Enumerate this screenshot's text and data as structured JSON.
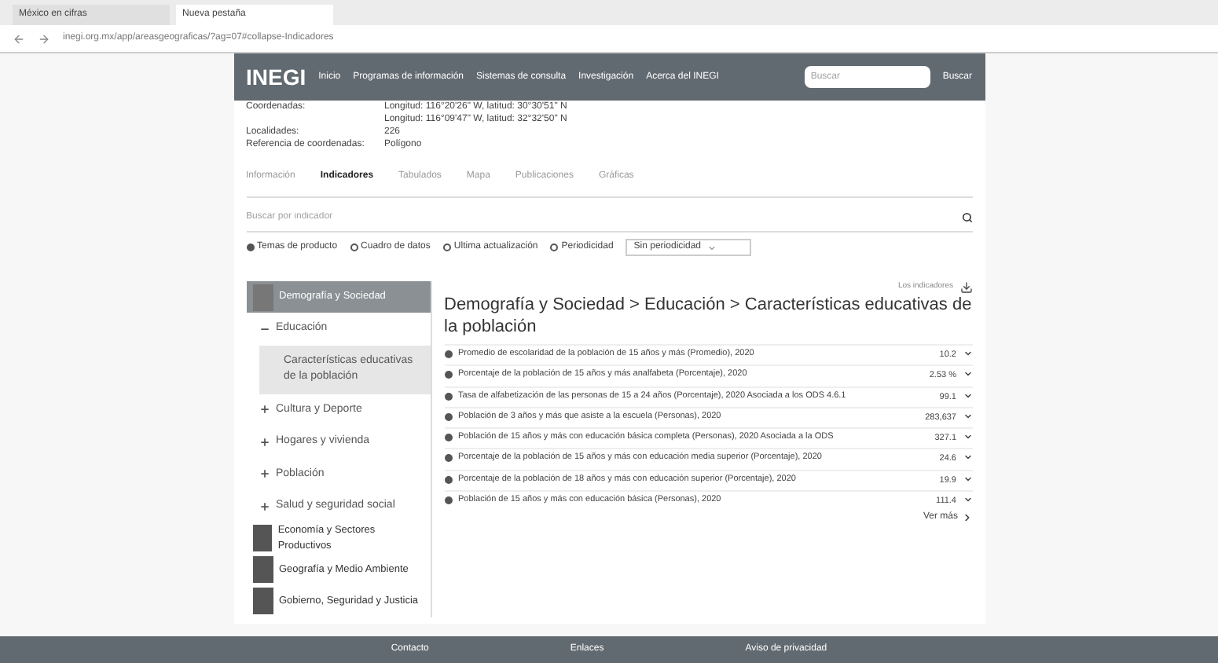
{
  "browser": {
    "tabs": [
      {
        "label": "México en cifras",
        "selected": false
      },
      {
        "label": "Nueva pestaña",
        "selected": true
      }
    ],
    "url": "inegi.org.mx/app/areasgeograficas/?ag=07#collapse-Indicadores"
  },
  "header": {
    "logo": "INEGI",
    "nav": [
      "Inicio",
      "Programas de información",
      "Sistemas de consulta",
      "Investigación",
      "Acerca del INEGI"
    ],
    "search": {
      "placeholder": "Buscar"
    },
    "search_button": "Buscar"
  },
  "info": [
    {
      "label": "Coordenadas:",
      "value": "Longitud: 116°20'26\" W, latitud: 30°30'51\" N"
    },
    {
      "value": "Longitud: 116°09'47\" W, latitud: 32°32'50\" N"
    },
    {
      "label": "Localidades:",
      "value": "226"
    },
    {
      "label": "Referencia de coordenadas:",
      "value": "Polígono"
    }
  ],
  "tabs": [
    {
      "label": "Información",
      "selected": false
    },
    {
      "label": "Indicadores",
      "selected": true
    },
    {
      "label": "Tabulados",
      "selected": false
    },
    {
      "label": "Mapa",
      "selected": false
    },
    {
      "label": "Publicaciones",
      "selected": false
    },
    {
      "label": "Gráficas",
      "selected": false
    }
  ],
  "filter": {
    "placeholder": "Buscar por indicador"
  },
  "radios": [
    {
      "label": "Temas de producto",
      "selected": true
    },
    {
      "label": "Cuadro de datos",
      "selected": false
    },
    {
      "label": "Ultima actualización",
      "selected": false
    },
    {
      "label": "Periodicidad",
      "selected": false
    }
  ],
  "dropdown": "Sin periodicidad",
  "sidebar": [
    {
      "label": "Demografía y Sociedad",
      "selected": true,
      "children": [
        {
          "label": "Educación",
          "expanded": true,
          "children": [
            {
              "label": "Características educativas de la población",
              "selected": true
            }
          ]
        },
        {
          "label": "Cultura y Deporte",
          "expanded": false
        },
        {
          "label": "Hogares y vivienda",
          "expanded": false
        },
        {
          "label": "Población",
          "expanded": false
        },
        {
          "label": "Salud y seguridad social",
          "expanded": false
        }
      ]
    },
    {
      "label": "Economía y Sectores Productivos",
      "selected": false
    },
    {
      "label": "Geografía y Medio Ambiente",
      "selected": false
    },
    {
      "label": "Gobierno, Seguridad y Justicia",
      "selected": false
    }
  ],
  "download": "Los indicadores",
  "heading": "Demografía y Sociedad > Educación > Características educativas de la población",
  "indicators": [
    {
      "label": "Promedio de escolaridad de la población de 15 años y más (Promedio), 2020",
      "value": "10.2"
    },
    {
      "label": "Porcentaje de la población de 15 años y más analfabeta (Porcentaje), 2020",
      "value": "2.53 %"
    },
    {
      "label": "Tasa de alfabetización de las personas de 15 a 24 años (Porcentaje), 2020 Asociada a los ODS 4.6.1",
      "value": "99.1"
    },
    {
      "label": "Población de 3 años y más que asiste a la escuela (Personas), 2020",
      "value": "283,637"
    },
    {
      "label": "Población de 15 años y más con educación básica completa (Personas), 2020 Asociada a la ODS",
      "value": "327.1"
    },
    {
      "label": "Porcentaje de la población de 15 años y más con educación media superior (Porcentaje), 2020",
      "value": "24.6"
    },
    {
      "label": "Porcentaje de la población de 18 años y más con educación superior (Porcentaje), 2020",
      "value": "19.9"
    },
    {
      "label": "Población de 15 años y más con educación básica (Personas), 2020",
      "value": "111.4"
    }
  ],
  "more": "Ver más",
  "footer": [
    "Contacto",
    "Enlaces",
    "Aviso de privacidad"
  ]
}
